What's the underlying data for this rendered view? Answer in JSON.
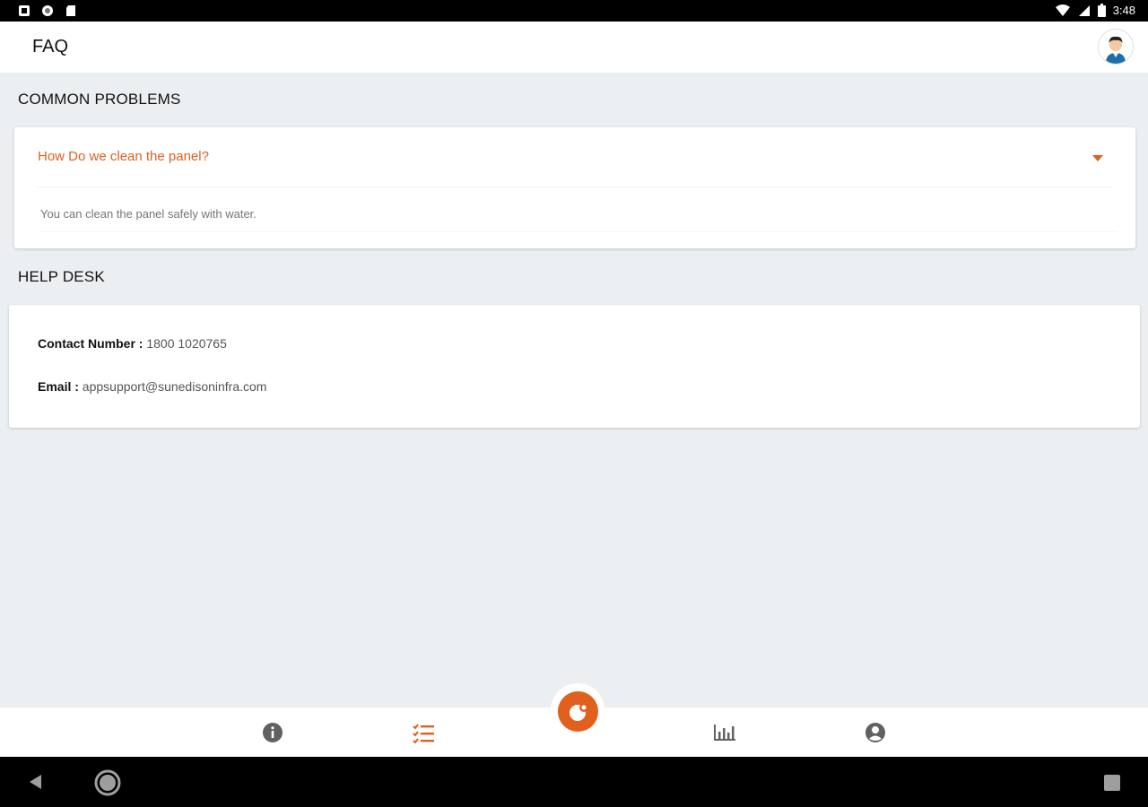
{
  "status_bar": {
    "time": "3:48",
    "left_icons": [
      "notification-icon",
      "sync-icon",
      "sd-card-icon"
    ],
    "right_icons": [
      "wifi-icon",
      "signal-icon",
      "battery-icon"
    ]
  },
  "app_bar": {
    "title": "FAQ",
    "avatar_icon": "user-avatar-icon"
  },
  "common_problems": {
    "heading": "COMMON PROBLEMS",
    "items": [
      {
        "question": "How Do we clean the panel?",
        "answer": "You can clean the panel safely with water.",
        "expanded": true
      }
    ]
  },
  "help_desk": {
    "heading": "HELP DESK",
    "contact_label": "Contact Number :",
    "contact_value": "1800 1020765",
    "email_label": "Email :",
    "email_value": "appsupport@sunedisoninfra.com"
  },
  "bottom_nav": {
    "items": [
      "info-icon",
      "checklist-icon",
      "solar-fab-icon",
      "bar-chart-icon",
      "account-icon"
    ],
    "active": "checklist-icon",
    "accent_color": "#e2601e",
    "inactive_color": "#616161"
  },
  "colors": {
    "accent": "#e0601f",
    "background": "#eceff1",
    "card": "#ffffff"
  }
}
